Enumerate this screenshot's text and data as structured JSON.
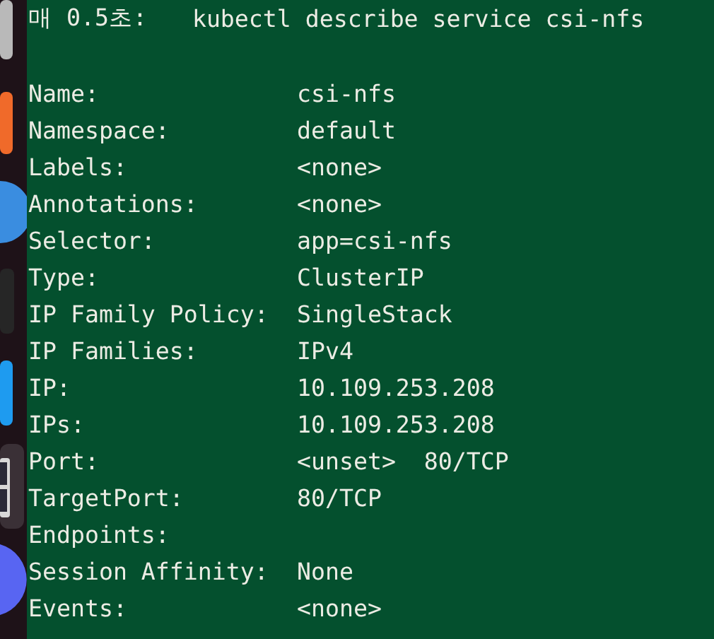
{
  "dock": {
    "items": [
      {
        "kind": "gray"
      },
      {
        "kind": "orange"
      },
      {
        "kind": "blue-circle"
      },
      {
        "kind": "dark"
      },
      {
        "kind": "blue"
      },
      {
        "kind": "window",
        "selected": true
      },
      {
        "kind": "purple-circle"
      }
    ]
  },
  "terminal": {
    "interval": "매 0.5초:",
    "command": "kubectl describe service csi-nfs",
    "rows": [
      {
        "key": "Name:",
        "value": "csi-nfs"
      },
      {
        "key": "Namespace:",
        "value": "default"
      },
      {
        "key": "Labels:",
        "value": "<none>"
      },
      {
        "key": "Annotations:",
        "value": "<none>"
      },
      {
        "key": "Selector:",
        "value": "app=csi-nfs"
      },
      {
        "key": "Type:",
        "value": "ClusterIP"
      },
      {
        "key": "IP Family Policy:",
        "value": "SingleStack"
      },
      {
        "key": "IP Families:",
        "value": "IPv4"
      },
      {
        "key": "IP:",
        "value": "10.109.253.208"
      },
      {
        "key": "IPs:",
        "value": "10.109.253.208"
      },
      {
        "key": "Port:",
        "value": "<unset>  80/TCP"
      },
      {
        "key": "TargetPort:",
        "value": "80/TCP"
      },
      {
        "key": "Endpoints:"
      },
      {
        "key": "Session Affinity:",
        "value": "None"
      },
      {
        "key": "Events:",
        "value": "<none>"
      }
    ]
  }
}
